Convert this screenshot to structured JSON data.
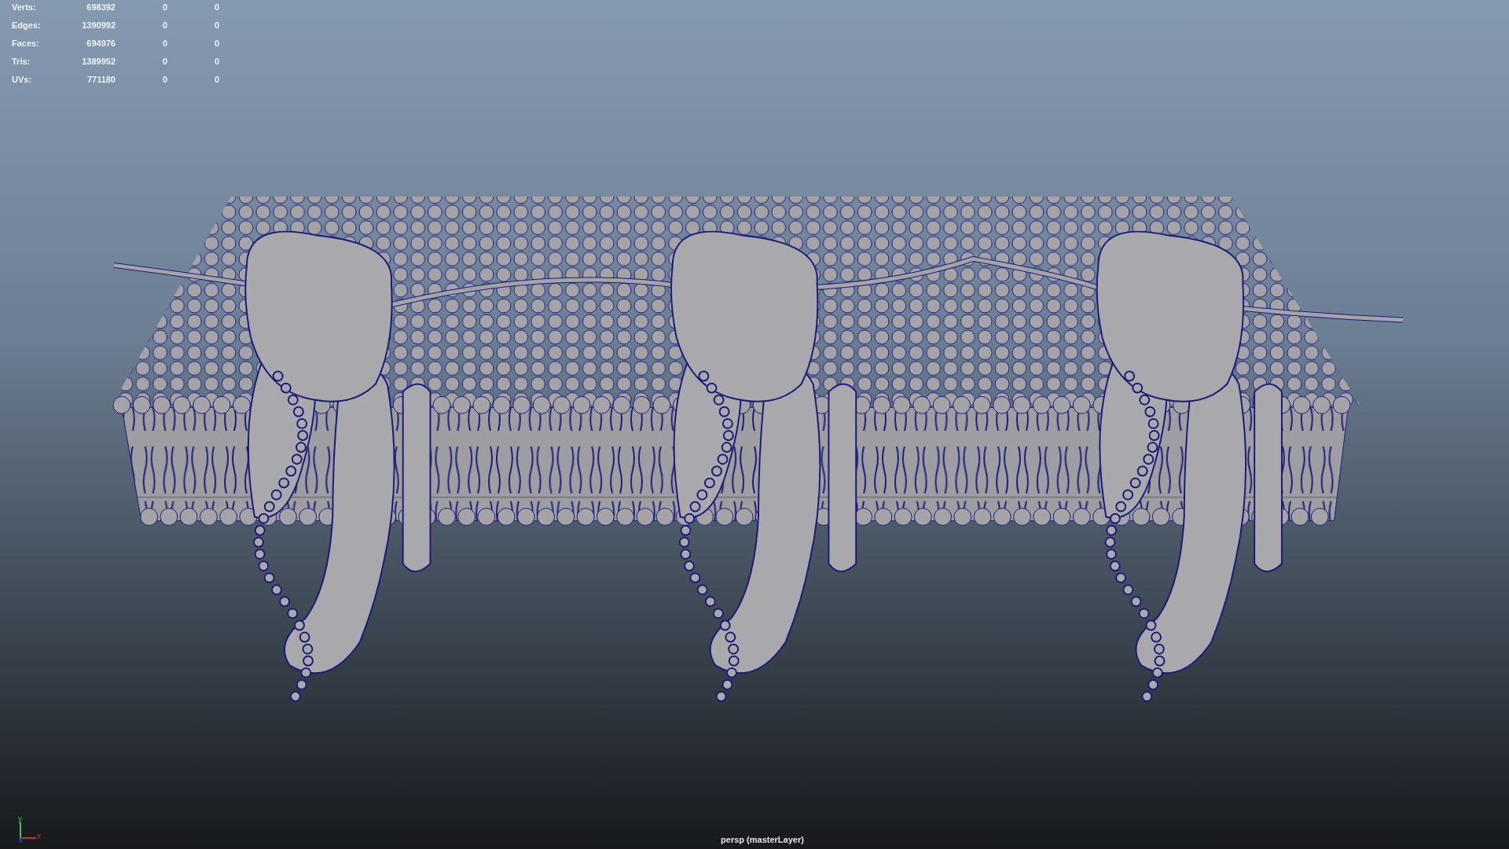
{
  "hud": {
    "rows": [
      {
        "label": "Verts:",
        "total": "698392",
        "selected": "0",
        "uv": "0"
      },
      {
        "label": "Edges:",
        "total": "1390992",
        "selected": "0",
        "uv": "0"
      },
      {
        "label": "Faces:",
        "total": "694976",
        "selected": "0",
        "uv": "0"
      },
      {
        "label": "Tris:",
        "total": "1389952",
        "selected": "0",
        "uv": "0"
      },
      {
        "label": "UVs:",
        "total": "771180",
        "selected": "0",
        "uv": "0"
      }
    ]
  },
  "axis": {
    "y": "y",
    "x": "x"
  },
  "camera_label": "persp (masterLayer)"
}
